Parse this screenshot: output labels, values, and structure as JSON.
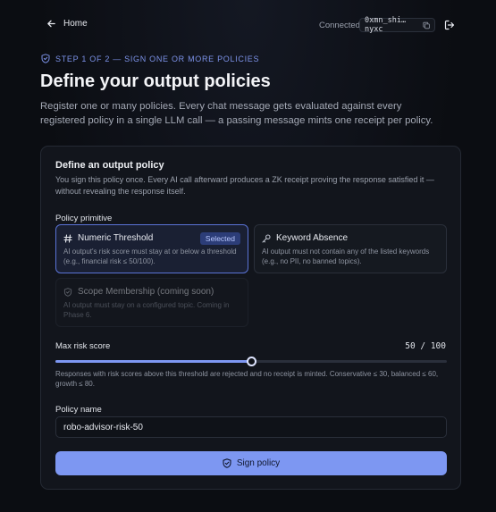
{
  "topbar": {
    "home_label": "Home",
    "connected_label": "Connected",
    "address": "0xmn_shi…nyxc"
  },
  "header": {
    "step": "STEP 1 OF 2 — SIGN ONE OR MORE POLICIES",
    "title": "Define your output policies",
    "description": "Register one or many policies. Every chat message gets evaluated against every registered policy in a single LLM call — a passing message mints one receipt per policy."
  },
  "card": {
    "title": "Define an output policy",
    "description": "You sign this policy once. Every AI call afterward produces a ZK receipt proving the response satisfied it — without revealing the response itself.",
    "primitive_label": "Policy primitive",
    "options": [
      {
        "title": "Numeric Threshold",
        "description": "AI output's risk score must stay at or below a threshold (e.g., financial risk ≤ 50/100).",
        "badge": "Selected",
        "icon": "hash-icon",
        "state": "selected"
      },
      {
        "title": "Keyword Absence",
        "description": "AI output must not contain any of the listed keywords (e.g., no PII, no banned topics).",
        "icon": "key-icon",
        "state": "default"
      },
      {
        "title": "Scope Membership (coming soon)",
        "description": "AI output must stay on a configured topic. Coming in Phase 6.",
        "icon": "shield-icon",
        "state": "disabled"
      }
    ],
    "risk": {
      "label": "Max risk score",
      "value": 50,
      "max": 100,
      "display": "50 / 100",
      "hint": "Responses with risk scores above this threshold are rejected and no receipt is minted. Conservative ≤ 30, balanced ≤ 60, growth ≤ 80."
    },
    "policy_name": {
      "label": "Policy name",
      "value": "robo-advisor-risk-50"
    },
    "submit_label": "Sign policy"
  },
  "colors": {
    "accent": "#7d97f2",
    "background": "#0b0d12",
    "card": "#12151c"
  }
}
